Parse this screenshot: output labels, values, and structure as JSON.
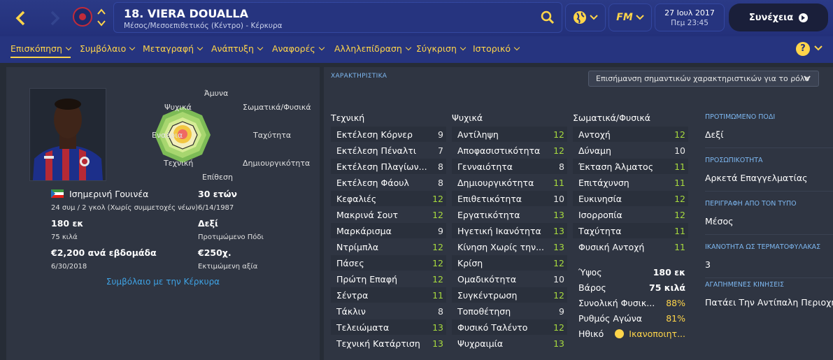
{
  "header": {
    "player_name": "18. VIERA DOUALLA",
    "subtitle": "Μέσος/Μεσοεπιθετικός (Κέντρο) - Κέρκυρα",
    "date": "27 Ιουλ 2017",
    "time": "Πεμ 23:45",
    "continue_label": "Συνέχεια"
  },
  "tabs": [
    "Επισκόπηση",
    "Συμβόλαιο",
    "Μεταγραφή",
    "Ανάπτυξη",
    "Αναφορές",
    "Αλληλεπίδραση",
    "Σύγκριση",
    "Ιστορικό"
  ],
  "radar": {
    "labels": [
      "Άμυνα",
      "Σωματικά/Φυσικά",
      "Ταχύτητα",
      "Δημιουργικότητα",
      "Επίθεση",
      "Τεχνική",
      "Εναέρια",
      "Ψυχικά"
    ]
  },
  "profile": {
    "nationality": "Ισημερινή Γουινέα",
    "caps": "24 συμ / 2 γκολ (Χωρίς συμμετοχές νέων)",
    "age": "30 ετών",
    "dob": "6/14/1987",
    "height": "180 εκ",
    "weight": "75 κιλά",
    "foot": "Δεξί",
    "foot_label": "Προτιμώμενο Πόδι",
    "wage": "€2,200 ανά εβδομάδα",
    "contract_end": "6/30/2018",
    "value": "€250χ.",
    "value_label": "Εκτιμώμενη αξία",
    "contract_link": "Συμβόλαιο με την Κέρκυρα"
  },
  "attributes": {
    "title": "ΧΑΡΑΚΤΗΡΙΣΤΙΚΑ",
    "highlight_dropdown": "Επισήμανση σημαντικών χαρακτηριστικών για το ρόλο",
    "technical": {
      "title": "Τεχνική",
      "items": [
        {
          "label": "Εκτέλεση Κόρνερ",
          "value": "9"
        },
        {
          "label": "Εκτέλεση Πέναλτι",
          "value": "7"
        },
        {
          "label": "Εκτέλεση Πλαγίων...",
          "value": "8"
        },
        {
          "label": "Εκτέλεση Φάουλ",
          "value": "8"
        },
        {
          "label": "Κεφαλιές",
          "value": "12"
        },
        {
          "label": "Μακρινά Σουτ",
          "value": "12"
        },
        {
          "label": "Μαρκάρισμα",
          "value": "9"
        },
        {
          "label": "Ντρίμπλα",
          "value": "12"
        },
        {
          "label": "Πάσες",
          "value": "12"
        },
        {
          "label": "Πρώτη Επαφή",
          "value": "12"
        },
        {
          "label": "Σέντρα",
          "value": "11"
        },
        {
          "label": "Τάκλιν",
          "value": "8"
        },
        {
          "label": "Τελειώματα",
          "value": "13"
        },
        {
          "label": "Τεχνική Κατάρτιση",
          "value": "13"
        }
      ]
    },
    "mental": {
      "title": "Ψυχικά",
      "items": [
        {
          "label": "Αντίληψη",
          "value": "12"
        },
        {
          "label": "Αποφασιστικότητα",
          "value": "12"
        },
        {
          "label": "Γενναιότητα",
          "value": "8"
        },
        {
          "label": "Δημιουργικότητα",
          "value": "11"
        },
        {
          "label": "Επιθετικότητα",
          "value": "10"
        },
        {
          "label": "Εργατικότητα",
          "value": "13"
        },
        {
          "label": "Ηγετική Ικανότητα",
          "value": "13"
        },
        {
          "label": "Κίνηση Χωρίς την...",
          "value": "13"
        },
        {
          "label": "Κρίση",
          "value": "12"
        },
        {
          "label": "Ομαδικότητα",
          "value": "10"
        },
        {
          "label": "Συγκέντρωση",
          "value": "12"
        },
        {
          "label": "Τοποθέτηση",
          "value": "9"
        },
        {
          "label": "Φυσικό Ταλέντο",
          "value": "12"
        },
        {
          "label": "Ψυχραιμία",
          "value": "13"
        }
      ]
    },
    "physical": {
      "title": "Σωματικά/Φυσικά",
      "items": [
        {
          "label": "Αντοχή",
          "value": "12"
        },
        {
          "label": "Δύναμη",
          "value": "10"
        },
        {
          "label": "Έκταση Άλματος",
          "value": "11"
        },
        {
          "label": "Επιτάχυνση",
          "value": "11"
        },
        {
          "label": "Ευκινησία",
          "value": "12"
        },
        {
          "label": "Ισορροπία",
          "value": "12"
        },
        {
          "label": "Ταχύτητα",
          "value": "11"
        },
        {
          "label": "Φυσική Αντοχή",
          "value": "11"
        }
      ]
    },
    "extras": [
      {
        "label": "Ύψος",
        "value": "180 εκ"
      },
      {
        "label": "Βάρος",
        "value": "75 κιλά"
      },
      {
        "label": "Συνολική Φυσικ...",
        "value": "88%"
      },
      {
        "label": "Ρυθμός Αγώνα",
        "value": "81%"
      },
      {
        "label": "Ηθικό",
        "value": "Ικανοποιητ..."
      }
    ]
  },
  "side": {
    "foot_h": "ΠΡΟΤΙΜΩΜΕΝΟ ΠΟΔΙ",
    "foot_v": "Δεξί",
    "pers_h": "ΠΡΟΣΩΠΙΚΟΤΗΤΑ",
    "pers_v": "Αρκετά Επαγγελματίας",
    "media_h": "ΠΕΡΙΓΡΑΦΗ ΑΠΟ ΤΟΝ ΤΥΠΟ",
    "media_v": "Μέσος",
    "gk_h": "ΙΚΑΝΟΤΗΤΑ ΩΣ ΤΕΡΜΑΤΟΦΥΛΑΚΑΣ",
    "gk_v": "3",
    "moves_h": "ΑΓΑΠΗΜΕΝΕΣ ΚΙΝΗΣΕΙΣ",
    "moves_v": "Πατάει Την Αντίπαλη Περιοχή"
  },
  "colors": {
    "accent": "#ffd54a",
    "good": "#a7da3e",
    "link": "#3fa4e6",
    "header": "#26347f"
  },
  "icons": {
    "back": "chevron-left-icon",
    "forward": "chevron-right-icon",
    "search": "search-icon",
    "globe": "globe-icon",
    "fm": "fm-logo-icon",
    "help": "help-icon",
    "continue": "play-circle-icon"
  }
}
